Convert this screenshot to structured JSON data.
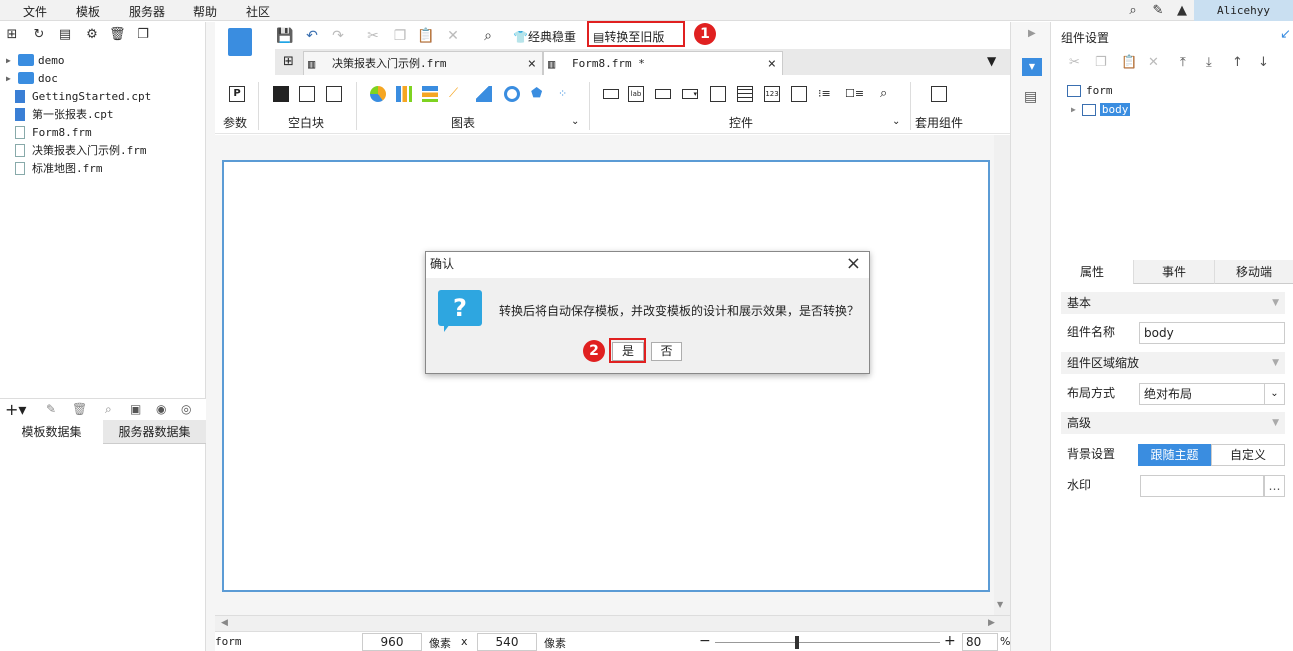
{
  "menubar": {
    "items": [
      "文件",
      "模板",
      "服务器",
      "帮助",
      "社区"
    ],
    "user": "Alicehyy"
  },
  "file_tree": {
    "items": [
      {
        "label": "demo",
        "type": "folder"
      },
      {
        "label": "doc",
        "type": "folder"
      },
      {
        "label": "GettingStarted.cpt",
        "type": "cpt"
      },
      {
        "label": "第一张报表.cpt",
        "type": "cpt"
      },
      {
        "label": "Form8.frm",
        "type": "frm"
      },
      {
        "label": "决策报表入门示例.frm",
        "type": "frm"
      },
      {
        "label": "标准地图.frm",
        "type": "frm"
      }
    ]
  },
  "dataset_tabs": [
    "模板数据集",
    "服务器数据集"
  ],
  "toolbar": {
    "classic_label": "经典稳重",
    "convert_label": "转换至旧版"
  },
  "doc_tabs": [
    {
      "label": "决策报表入门示例.frm",
      "active": false
    },
    {
      "label": "Form8.frm *",
      "active": true
    }
  ],
  "widget_groups": {
    "param": "参数",
    "blank": "空白块",
    "chart": "图表",
    "control": "控件",
    "template_comp": "套用组件"
  },
  "statusbar": {
    "name": "form",
    "width": "960",
    "width_unit": "像素",
    "x": "x",
    "height": "540",
    "height_unit": "像素",
    "zoom": "80",
    "zoom_unit": "%"
  },
  "right_panel": {
    "title": "组件设置",
    "tree": [
      "form",
      "body"
    ],
    "tabs": [
      "属性",
      "事件",
      "移动端"
    ],
    "sections": {
      "basic": "基本",
      "zoom": "组件区域缩放",
      "advanced": "高级"
    },
    "fields": {
      "name_label": "组件名称",
      "name_value": "body",
      "layout_label": "布局方式",
      "layout_value": "绝对布局",
      "bg_label": "背景设置",
      "bg_option1": "跟随主题",
      "bg_option2": "自定义",
      "watermark_label": "水印",
      "watermark_btn": "…"
    }
  },
  "dialog": {
    "title": "确认",
    "message": "转换后将自动保存模板，并改变模板的设计和展示效果，是否转换？",
    "yes": "是",
    "no": "否"
  },
  "markers": [
    "1",
    "2"
  ],
  "colors": {
    "accent": "#3a8de0",
    "marker": "#e02020",
    "dialog_icon": "#2ea6e0"
  }
}
